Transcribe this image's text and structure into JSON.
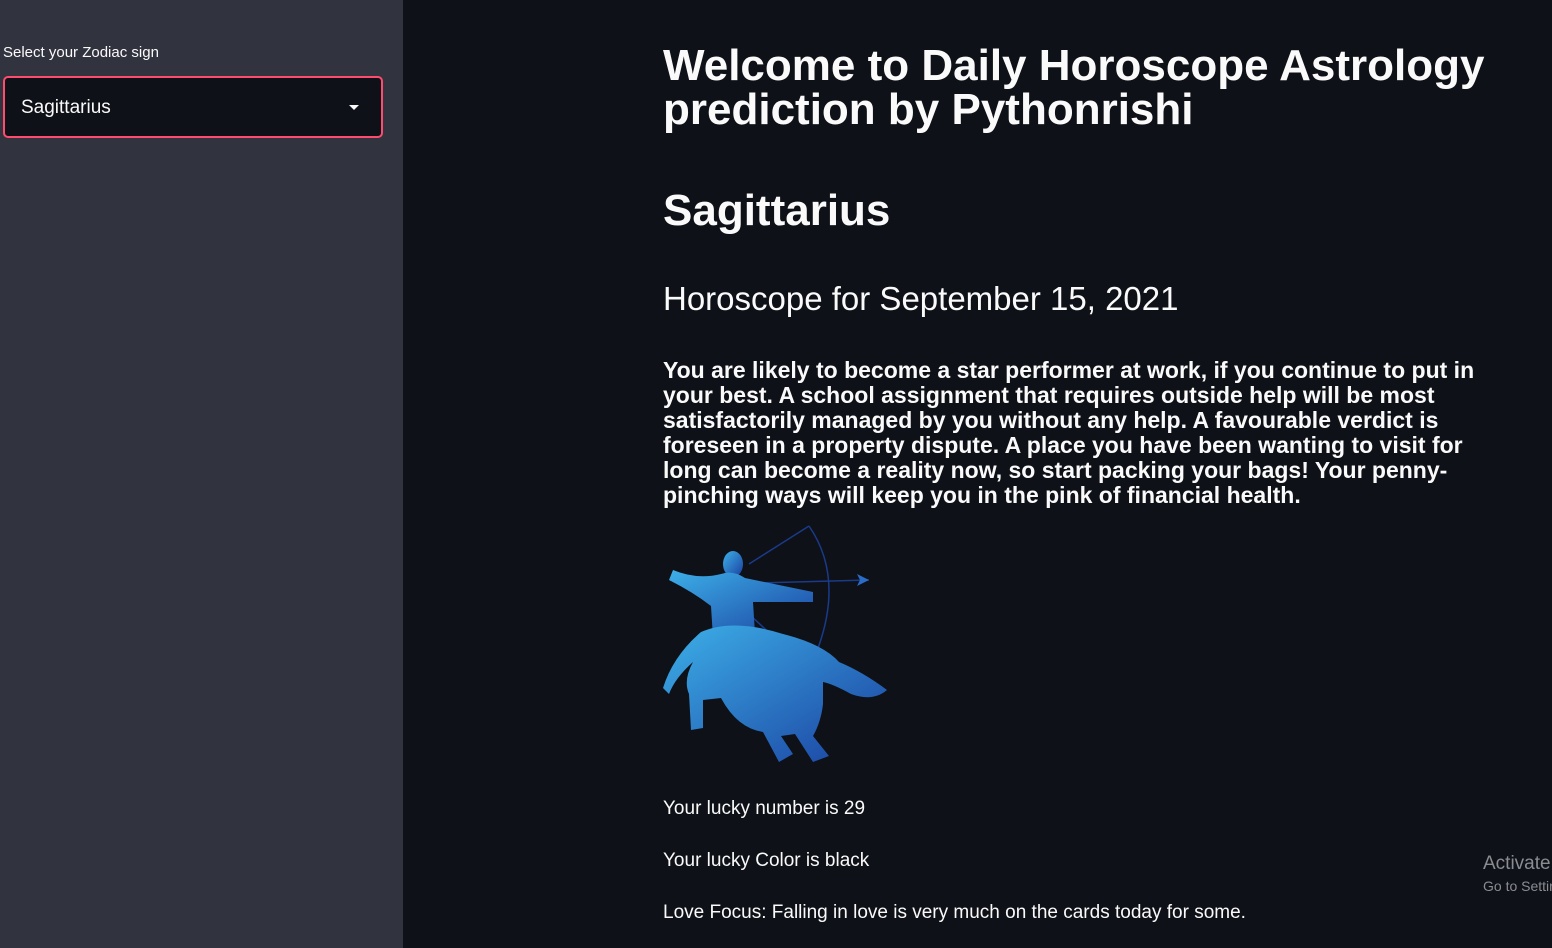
{
  "sidebar": {
    "select_label": "Select your Zodiac sign",
    "selected_sign": "Sagittarius"
  },
  "main": {
    "title": "Welcome to Daily Horoscope Astrology prediction by Pythonrishi",
    "sign_heading": "Sagittarius",
    "date_heading": "Horoscope for September 15, 2021",
    "prediction": "You are likely to become a star performer at work, if you continue to put in your best. A school assignment that requires outside help will be most satisfactorily managed by you without any help. A favourable verdict is foreseen in a property dispute. A place you have been wanting to visit for long can become a reality now, so start packing your bags! Your penny-pinching ways will keep you in the pink of financial health.",
    "image_icon": "sagittarius-centaur-archer-icon",
    "lucky_number": "Your lucky number is 29",
    "lucky_color": "Your lucky Color is black",
    "love_focus": "Love Focus: Falling in love is very much on the cards today for some."
  },
  "watermark": {
    "title": "Activate Windows",
    "subtitle": "Go to Settings to activate Windows."
  },
  "colors": {
    "sidebar_bg": "#31333f",
    "main_bg": "#0e1117",
    "select_border": "#ff4b6e",
    "text": "#fafafa",
    "zodiac_gradient_start": "#3db0e8",
    "zodiac_gradient_end": "#1a3fa0"
  }
}
